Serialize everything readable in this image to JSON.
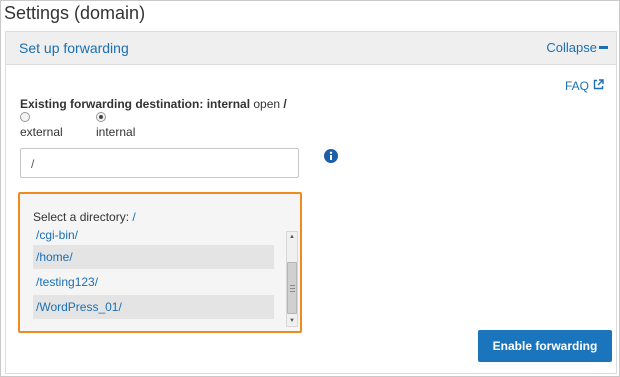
{
  "page": {
    "title": "Settings (domain)"
  },
  "panel": {
    "title": "Set up forwarding",
    "collapse_label": "Collapse",
    "faq_label": "FAQ"
  },
  "existing": {
    "label": "Existing forwarding destination:",
    "type": "internal",
    "mode": "open",
    "path": "/"
  },
  "radios": [
    {
      "label": "external",
      "checked": false
    },
    {
      "label": "internal",
      "checked": true
    }
  ],
  "path_input": {
    "value": "/"
  },
  "directory": {
    "label": "Select a directory:",
    "current": "/",
    "items": [
      "/cgi-bin/",
      "/home/",
      "/testing123/",
      "/WordPress_01/"
    ]
  },
  "button": {
    "label": "Enable forwarding"
  },
  "colors": {
    "link": "#1a6fb5",
    "button": "#1b75bc",
    "highlight_border": "#ef8a1f"
  },
  "icons": [
    "external-link-icon",
    "info-icon",
    "collapse-minus-icon",
    "scroll-up-icon",
    "scroll-down-icon"
  ]
}
